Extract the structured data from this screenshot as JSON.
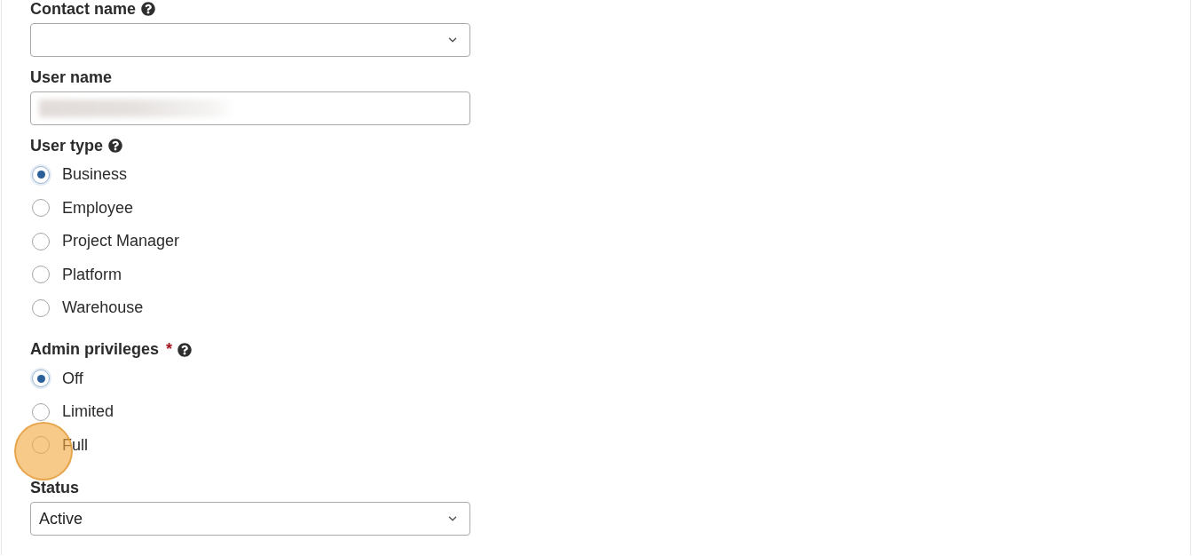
{
  "fields": [
    {
      "kind": "select",
      "label": "Contact name",
      "help": true
    },
    {
      "kind": "text",
      "label": "User name",
      "help": false,
      "redacted": true
    },
    {
      "kind": "radio",
      "label": "User type",
      "help": true,
      "options": [
        {
          "label": "Business",
          "selected": true,
          "click_marker": false
        },
        {
          "label": "Employee",
          "selected": false,
          "click_marker": false
        },
        {
          "label": "Project Manager",
          "selected": false,
          "click_marker": false
        },
        {
          "label": "Platform",
          "selected": false,
          "click_marker": false
        },
        {
          "label": "Warehouse",
          "selected": false,
          "click_marker": false
        }
      ]
    },
    {
      "kind": "radio",
      "label": "Admin privileges",
      "required_mark": "*",
      "help": true,
      "options": [
        {
          "label": "Off",
          "selected": true,
          "click_marker": false
        },
        {
          "label": "Limited",
          "selected": false,
          "click_marker": false
        },
        {
          "label": "Full",
          "selected": false,
          "click_marker": true
        }
      ]
    },
    {
      "kind": "select",
      "label": "Status",
      "help": false,
      "value": "Active"
    }
  ]
}
